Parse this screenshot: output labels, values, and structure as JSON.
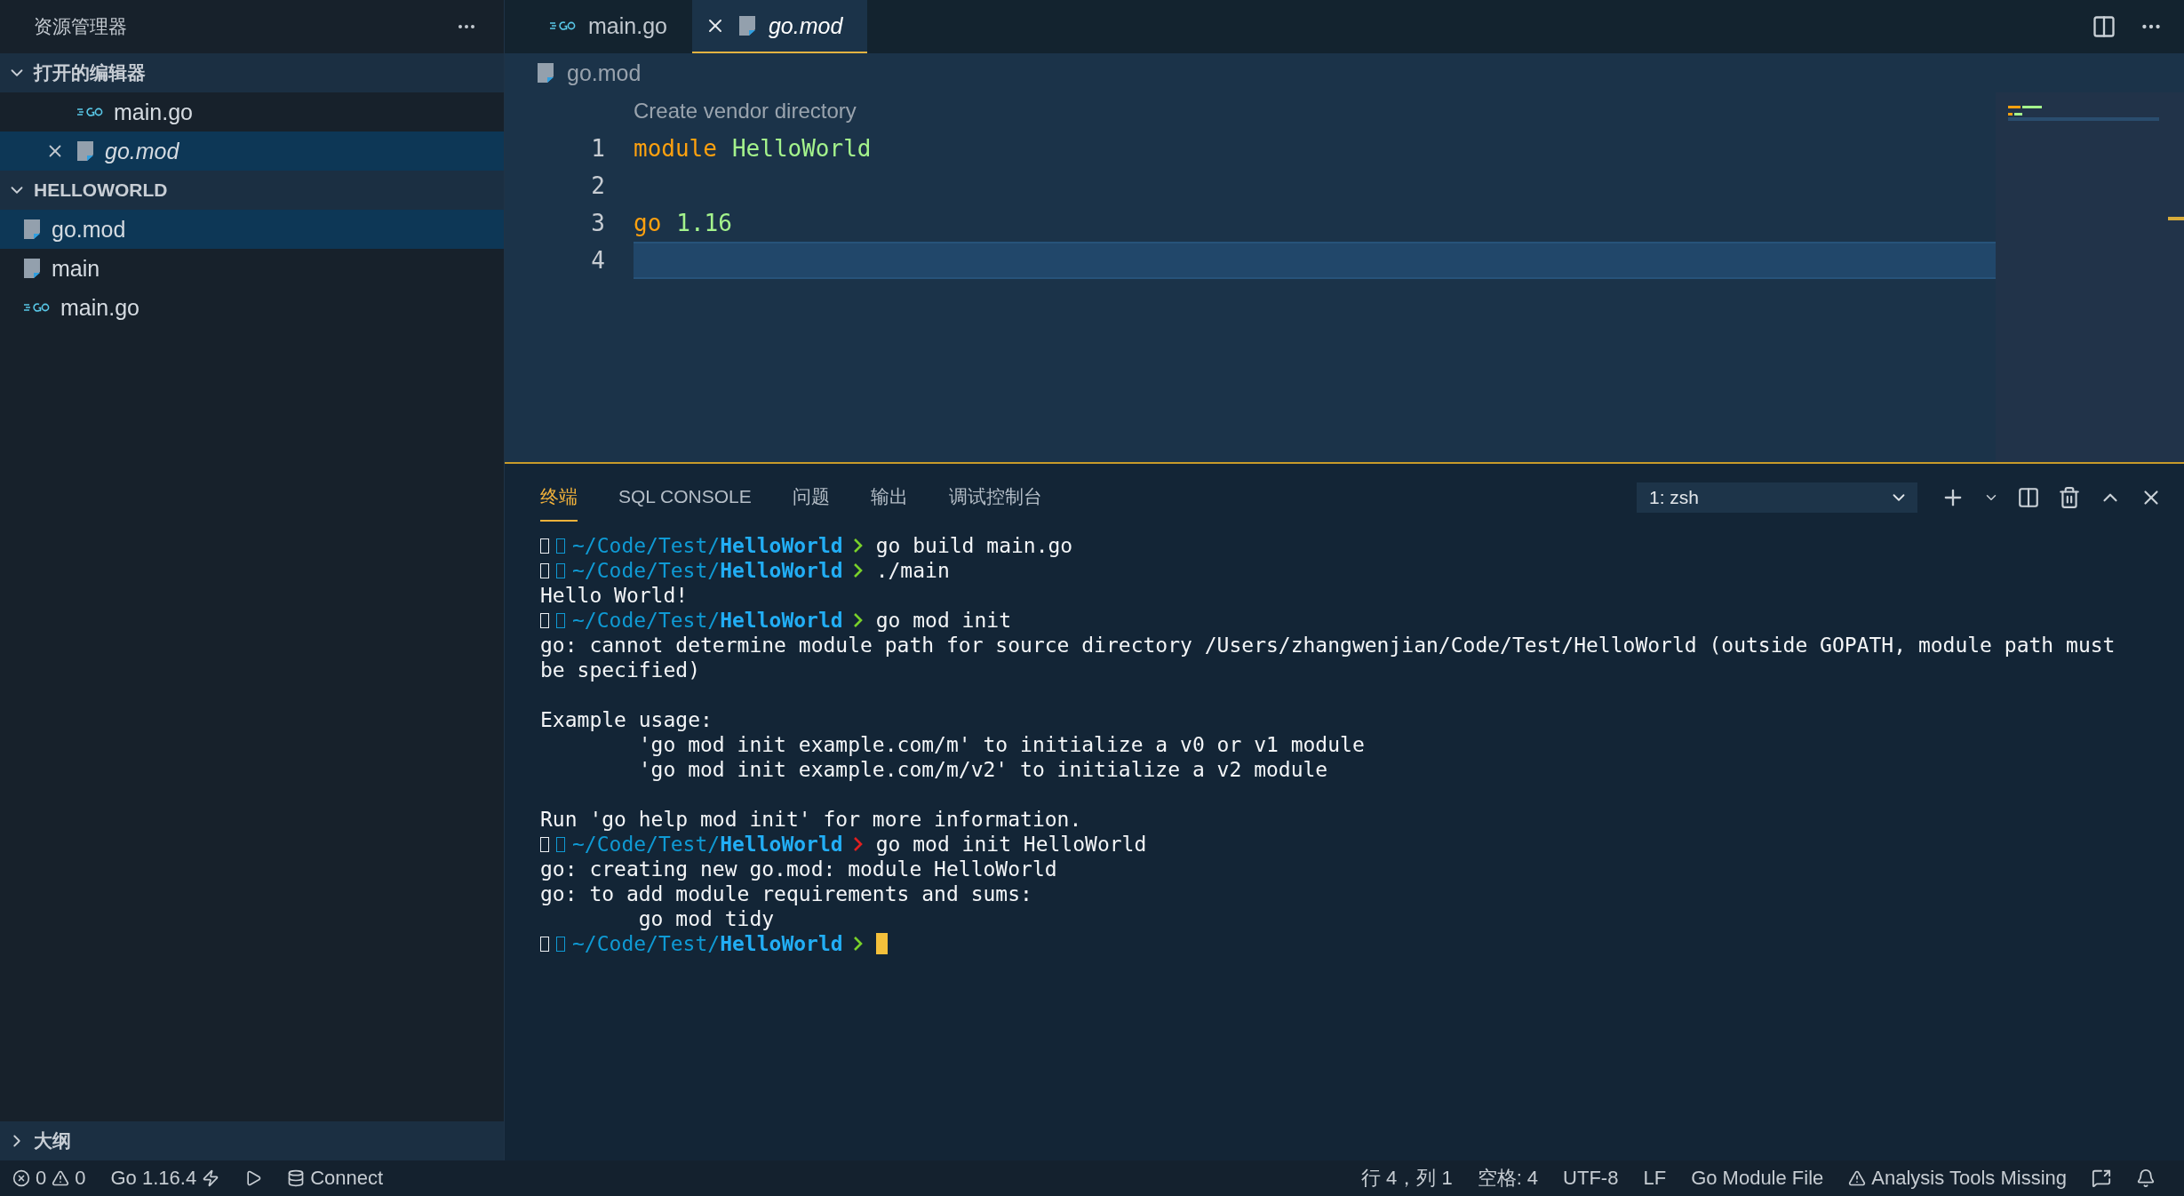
{
  "sidebar": {
    "title": "资源管理器",
    "sections": [
      {
        "title": "打开的编辑器",
        "expanded": true,
        "indent": true,
        "items": [
          {
            "name": "main.go",
            "kind": "go",
            "selected": false,
            "preview": false,
            "close_visible": false
          },
          {
            "name": "go.mod",
            "kind": "file",
            "selected": true,
            "preview": true,
            "close_visible": true
          }
        ]
      },
      {
        "title": "HELLOWORLD",
        "expanded": true,
        "indent": false,
        "items": [
          {
            "name": "go.mod",
            "kind": "file",
            "selected": true,
            "preview": false
          },
          {
            "name": "main",
            "kind": "file",
            "selected": false,
            "preview": false
          },
          {
            "name": "main.go",
            "kind": "go",
            "selected": false,
            "preview": false
          }
        ]
      }
    ],
    "outline": {
      "title": "大纲",
      "expanded": false
    }
  },
  "tabs": [
    {
      "label": "main.go",
      "kind": "go",
      "selected": false,
      "preview": false
    },
    {
      "label": "go.mod",
      "kind": "file",
      "selected": true,
      "preview": true
    }
  ],
  "breadcrumb": {
    "label": "go.mod",
    "kind": "file"
  },
  "editor": {
    "codelens": "Create vendor directory",
    "lines": [
      {
        "number": "1",
        "current": false,
        "tokens": [
          {
            "text": "module",
            "kind": "keyword"
          },
          {
            "text": "HelloWorld",
            "kind": "name"
          }
        ]
      },
      {
        "number": "2",
        "current": false
      },
      {
        "number": "3",
        "current": false,
        "tokens": [
          {
            "text": "go",
            "kind": "keyword"
          },
          {
            "text": "1.16",
            "kind": "name"
          }
        ]
      },
      {
        "number": "4",
        "current": true
      }
    ]
  },
  "panel": {
    "tabs": [
      {
        "label": "终端",
        "selected": true
      },
      {
        "label": "SQL CONSOLE",
        "selected": false
      },
      {
        "label": "问题",
        "selected": false
      },
      {
        "label": "输出",
        "selected": false
      },
      {
        "label": "调试控制台",
        "selected": false
      }
    ],
    "terminal_select": "1: zsh",
    "lines": [
      {
        "kind": "prompt",
        "path": "~/Code/Test/",
        "dir": "HelloWorld",
        "ok": true,
        "command": "go build main.go",
        "cursor": false
      },
      {
        "kind": "prompt",
        "path": "~/Code/Test/",
        "dir": "HelloWorld",
        "ok": true,
        "command": "./main",
        "cursor": false
      },
      {
        "kind": "output",
        "text": "Hello World!"
      },
      {
        "kind": "prompt",
        "path": "~/Code/Test/",
        "dir": "HelloWorld",
        "ok": true,
        "command": "go mod init",
        "cursor": false
      },
      {
        "kind": "output",
        "text": "go: cannot determine module path for source directory /Users/zhangwenjian/Code/Test/HelloWorld (outside GOPATH, module path must"
      },
      {
        "kind": "output",
        "text": "be specified)"
      },
      {
        "kind": "blank"
      },
      {
        "kind": "output",
        "text": "Example usage:"
      },
      {
        "kind": "output",
        "text": "        'go mod init example.com/m' to initialize a v0 or v1 module"
      },
      {
        "kind": "output",
        "text": "        'go mod init example.com/m/v2' to initialize a v2 module"
      },
      {
        "kind": "blank"
      },
      {
        "kind": "output",
        "text": "Run 'go help mod init' for more information."
      },
      {
        "kind": "prompt",
        "path": "~/Code/Test/",
        "dir": "HelloWorld",
        "ok": false,
        "command": "go mod init HelloWorld",
        "cursor": false
      },
      {
        "kind": "output",
        "text": "go: creating new go.mod: module HelloWorld"
      },
      {
        "kind": "output",
        "text": "go: to add module requirements and sums:"
      },
      {
        "kind": "output",
        "text": "        go mod tidy"
      },
      {
        "kind": "prompt",
        "path": "~/Code/Test/",
        "dir": "HelloWorld",
        "ok": true,
        "cursor": true
      }
    ]
  },
  "status_bar": {
    "errors": "0",
    "warnings": "0",
    "go_version": "Go 1.16.4",
    "connect": "Connect",
    "right": [
      {
        "text": "行 4，列 1",
        "kind": "plain"
      },
      {
        "text": "空格: 4",
        "kind": "plain"
      },
      {
        "text": "UTF-8",
        "kind": "plain"
      },
      {
        "text": "LF",
        "kind": "plain"
      },
      {
        "text": "Go Module File",
        "kind": "plain"
      },
      {
        "text": "Analysis Tools Missing",
        "kind": "warning"
      }
    ]
  }
}
